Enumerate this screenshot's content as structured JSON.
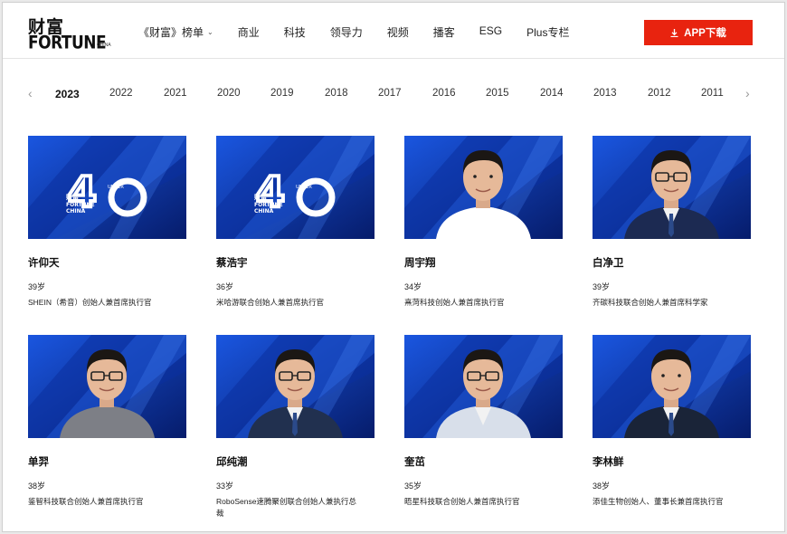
{
  "logo": {
    "cn": "财富",
    "en": "FORTUNE",
    "small": "CHINA"
  },
  "nav": [
    {
      "label": "《财富》榜单",
      "dropdown": true
    },
    {
      "label": "商业"
    },
    {
      "label": "科技"
    },
    {
      "label": "领导力"
    },
    {
      "label": "视频"
    },
    {
      "label": "播客"
    },
    {
      "label": "ESG"
    },
    {
      "label": "Plus专栏"
    }
  ],
  "app_button": "APP下载",
  "years": [
    "2023",
    "2022",
    "2021",
    "2020",
    "2019",
    "2018",
    "2017",
    "2016",
    "2015",
    "2014",
    "2013",
    "2012",
    "2011"
  ],
  "active_year": "2023",
  "badge": {
    "top": "40",
    "under": "UNDER",
    "cn": "财富",
    "en1": "FORTUNE",
    "en2": "CHINA"
  },
  "people": [
    {
      "name": "许仰天",
      "age": "39岁",
      "title": "SHEIN（希音）创始人兼首席执行官",
      "photo": "badge"
    },
    {
      "name": "蔡浩宇",
      "age": "36岁",
      "title": "米哈游联合创始人兼首席执行官",
      "photo": "badge"
    },
    {
      "name": "周宇翔",
      "age": "34岁",
      "title": "熹菏科技创始人兼首席执行官",
      "photo": "person"
    },
    {
      "name": "白净卫",
      "age": "39岁",
      "title": "齐碳科技联合创始人兼首席科学家",
      "photo": "person"
    },
    {
      "name": "单羿",
      "age": "38岁",
      "title": "鉴智科技联合创始人兼首席执行官",
      "photo": "person"
    },
    {
      "name": "邱纯潮",
      "age": "33岁",
      "title": "RoboSense速腾聚创联合创始人兼执行总裁",
      "photo": "person"
    },
    {
      "name": "奎茁",
      "age": "35岁",
      "title": "晤星科技联合创始人兼首席执行官",
      "photo": "person"
    },
    {
      "name": "李林鲜",
      "age": "38岁",
      "title": "添佳生物创始人、董事长兼首席执行官",
      "photo": "person"
    }
  ],
  "colors": {
    "accent": "#e8230f",
    "photo_bg": "#0a2a8f"
  }
}
